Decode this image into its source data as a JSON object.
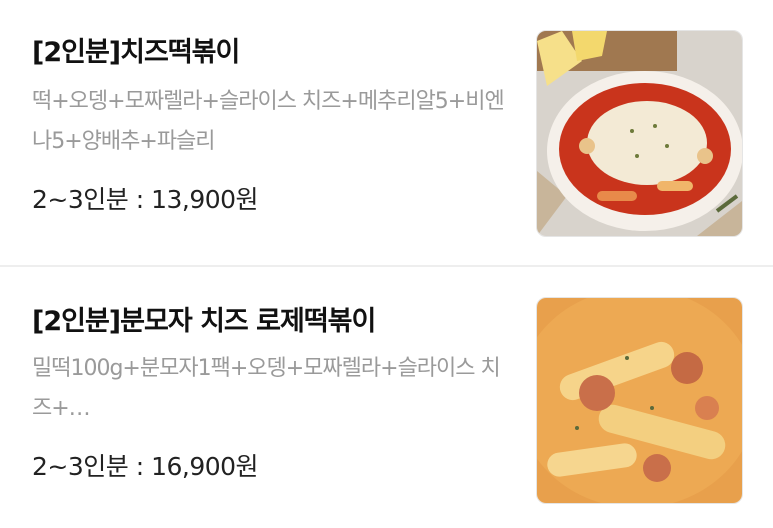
{
  "items": [
    {
      "title": "[2인분]치즈떡볶이",
      "description": "떡+오뎅+모짜렐라+슬라이스 치즈+메추리알5+비엔나5+양배추+파슬리",
      "price": "2~3인분 : 13,900원",
      "image_icon": "cheese-tteokbokki-photo"
    },
    {
      "title": "[2인분]분모자 치즈 로제떡볶이",
      "description": "밀떡100g+분모자1팩+오뎅+모짜렐라+슬라이스 치즈+…",
      "price": "2~3인분 : 16,900원",
      "image_icon": "rose-tteokbokki-photo"
    }
  ]
}
